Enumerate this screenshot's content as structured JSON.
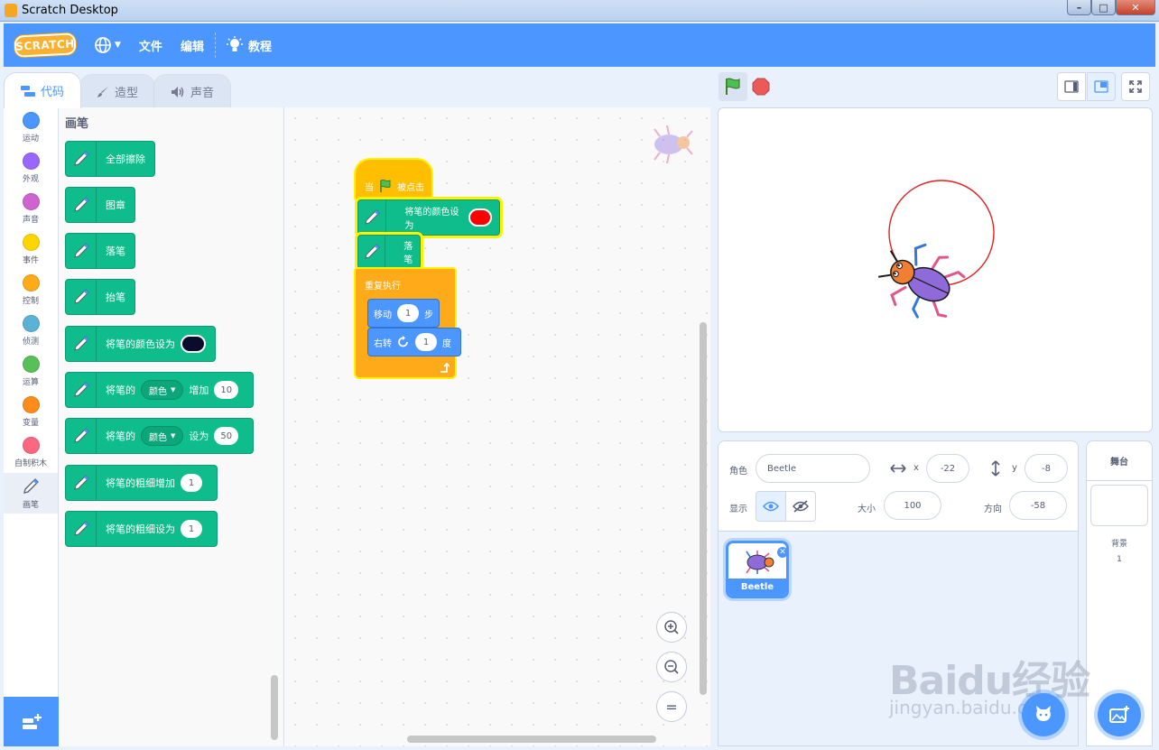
{
  "window": {
    "title": "Scratch Desktop",
    "min": "0",
    "max": "1",
    "close": "r"
  },
  "menubar": {
    "logo": "SCRATCH",
    "file": "文件",
    "edit": "编辑",
    "tutorials": "教程"
  },
  "tabs": [
    {
      "label": "代码"
    },
    {
      "label": "造型"
    },
    {
      "label": "声音"
    }
  ],
  "categories": [
    {
      "label": "运动",
      "color": "#4c97ff"
    },
    {
      "label": "外观",
      "color": "#9966ff"
    },
    {
      "label": "声音",
      "color": "#cf63cf"
    },
    {
      "label": "事件",
      "color": "#ffd500"
    },
    {
      "label": "控制",
      "color": "#ffab19"
    },
    {
      "label": "侦测",
      "color": "#5cb1d6"
    },
    {
      "label": "运算",
      "color": "#59c059"
    },
    {
      "label": "变量",
      "color": "#ff8c1a"
    },
    {
      "label": "自制积木",
      "color": "#ff6680"
    },
    {
      "label": "画笔",
      "color": "#0fbd8c"
    }
  ],
  "palette": {
    "title": "画笔",
    "erase_all": "全部擦除",
    "stamp": "图章",
    "pen_down": "落笔",
    "pen_up": "抬笔",
    "set_color": "将笔的颜色设为",
    "set_color_swatch": "#0b0b2e",
    "change_prefix": "将笔的",
    "change_param": "颜色",
    "change_suffix": "增加",
    "change_value": "10",
    "set_prefix": "将笔的",
    "set_param": "颜色",
    "set_suffix": "设为",
    "set_value": "50",
    "change_size": "将笔的粗细增加",
    "change_size_value": "1",
    "set_size": "将笔的粗细设为",
    "set_size_value": "1"
  },
  "script": {
    "hat_when": "当",
    "hat_clicked": "被点击",
    "set_color": "将笔的颜色设为",
    "set_color_swatch": "#ff0000",
    "pen_down": "落笔",
    "forever": "重复执行",
    "move": "移动",
    "move_value": "1",
    "move_unit": "步",
    "turn": "右转",
    "turn_value": "1",
    "turn_unit": "度"
  },
  "zoom": {
    "in": "+",
    "out": "−",
    "reset": "="
  },
  "sprite_info": {
    "sprite_label": "角色",
    "sprite_name": "Beetle",
    "x_label": "x",
    "x_value": "-22",
    "y_label": "y",
    "y_value": "-8",
    "show_label": "显示",
    "size_label": "大小",
    "size_value": "100",
    "direction_label": "方向",
    "direction_value": "-58"
  },
  "sprite_list": [
    {
      "name": "Beetle",
      "selected": true
    }
  ],
  "stage_pane": {
    "header": "舞台",
    "backdrops_label": "背景",
    "backdrops_count": "1"
  },
  "watermark": {
    "main": "Baidu经验",
    "sub": "jingyan.baidu.com"
  }
}
